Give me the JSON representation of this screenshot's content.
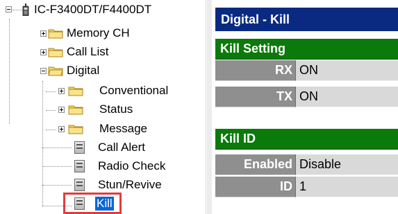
{
  "tree": {
    "root_label": "IC-F3400DT/F4400DT",
    "items": [
      {
        "label": "Memory CH",
        "icon": "folder-icon"
      },
      {
        "label": "Call List",
        "icon": "folder-icon"
      },
      {
        "label": "Digital",
        "icon": "folder-icon"
      },
      {
        "label": "Conventional",
        "icon": "folder-icon"
      },
      {
        "label": "Status",
        "icon": "folder-icon"
      },
      {
        "label": "Message",
        "icon": "folder-icon"
      },
      {
        "label": "Call Alert",
        "icon": "setting-page-icon"
      },
      {
        "label": "Radio Check",
        "icon": "setting-page-icon"
      },
      {
        "label": "Stun/Revive",
        "icon": "setting-page-icon"
      },
      {
        "label": "Kill",
        "icon": "setting-page-icon",
        "selected": true
      }
    ]
  },
  "panel": {
    "title": "Digital - Kill",
    "kill_setting": {
      "header": "Kill Setting",
      "rows": [
        {
          "label": "RX",
          "value": "ON"
        },
        {
          "label": "TX",
          "value": "ON"
        }
      ]
    },
    "kill_id": {
      "header": "Kill ID",
      "rows": [
        {
          "label": "Enabled",
          "value": "Disable"
        },
        {
          "label": "ID",
          "value": "1"
        }
      ]
    }
  },
  "colors": {
    "title_bar": "#0a2a82",
    "section_header": "#0a7a0a",
    "label_cell": "#8f8f8f",
    "value_cell": "#d9d9d9",
    "selection": "#0a66d8",
    "highlight_box": "#e33b3b"
  }
}
